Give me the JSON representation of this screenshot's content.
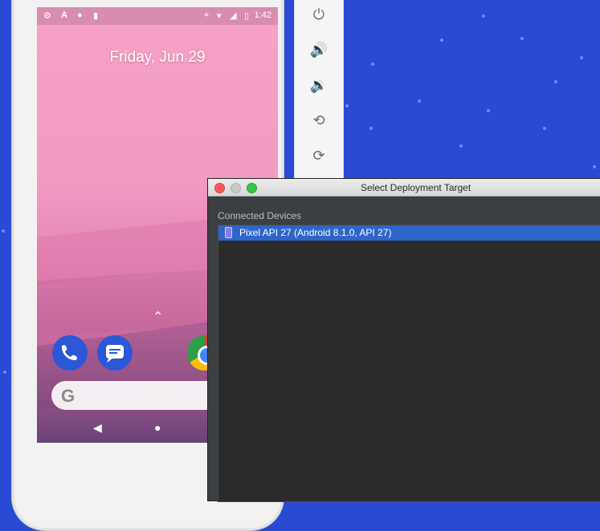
{
  "phone": {
    "status_bar": {
      "time": "1:42",
      "icons": [
        "settings-icon",
        "a-icon",
        "circle-icon",
        "sd-card-icon",
        "location-icon",
        "wifi-icon",
        "signal-icon",
        "battery-icon"
      ]
    },
    "lock_date": "Friday, Jun 29",
    "drawer_arrow_glyph": "⌃",
    "dock": [
      "phone-icon",
      "messages-icon",
      "chrome-icon"
    ],
    "search_logo": "G",
    "nav": {
      "back": "◀",
      "home": "●",
      "recents": "▮"
    }
  },
  "toolbar": {
    "buttons": [
      {
        "name": "power-icon",
        "glyph": "⏻"
      },
      {
        "name": "volume-up-icon",
        "glyph": "🔊"
      },
      {
        "name": "volume-down-icon",
        "glyph": "🔉"
      },
      {
        "name": "rotate-left-icon",
        "glyph": "⟲"
      },
      {
        "name": "rotate-right-icon",
        "glyph": "⟳"
      }
    ]
  },
  "dialog": {
    "title": "Select Deployment Target",
    "section": "Connected Devices",
    "devices": [
      {
        "label": "Pixel API 27 (Android 8.1.0, API 27)",
        "selected": true
      }
    ]
  },
  "colors": {
    "desktop": "#2a49d4",
    "selection": "#2f65ca",
    "dialog_bg": "#3c3f41"
  }
}
